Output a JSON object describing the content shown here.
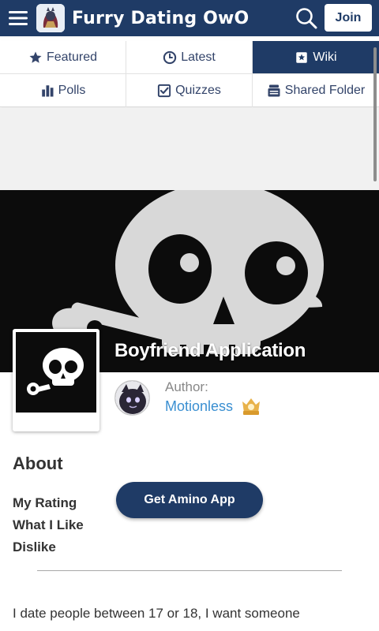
{
  "header": {
    "app_title": "Furry Dating OwO",
    "join_label": "Join",
    "icons": [
      "menu-icon",
      "search-icon"
    ],
    "bar_color": "#1f3b66"
  },
  "tabs": [
    {
      "label": "Featured",
      "icon": "star-icon"
    },
    {
      "label": "Latest",
      "icon": "clock-icon"
    },
    {
      "label": "Wiki",
      "icon": "wiki-star-icon",
      "active": true
    },
    {
      "label": "Polls",
      "icon": "bar-chart-icon"
    },
    {
      "label": "Quizzes",
      "icon": "checkbox-icon"
    },
    {
      "label": "Shared Folder",
      "icon": "folder-stack-icon"
    }
  ],
  "post": {
    "title": "Boyfriend Application",
    "author_label": "Author:",
    "author_name": "Motionless",
    "author_link_color": "#3a8fd1"
  },
  "about": {
    "heading": "About",
    "links": [
      "My Rating",
      "What I Like",
      "Dislike"
    ]
  },
  "cta": {
    "label": "Get Amino App"
  },
  "body": {
    "text": "I date people between 17 or 18, I want someone"
  }
}
